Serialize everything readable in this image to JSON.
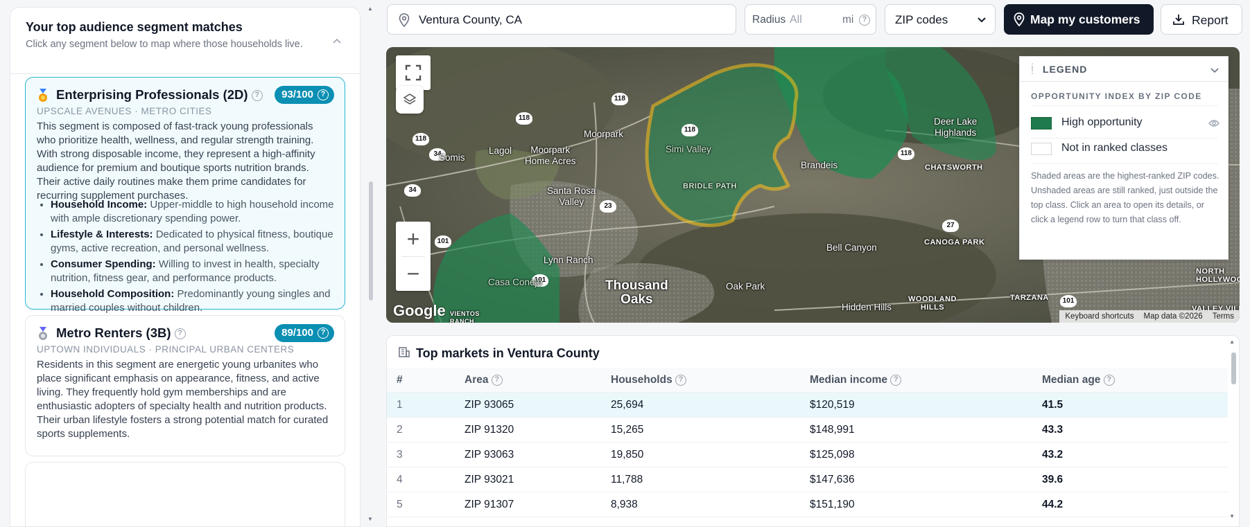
{
  "left_panel": {
    "title": "Your top audience segment matches",
    "subtitle": "Click any segment below to map where those households live.",
    "segments": [
      {
        "medal": "gold-medal-icon",
        "title": "Enterprising Professionals (2D)",
        "score": "93/100",
        "meta": "UPSCALE AVENUES · METRO CITIES",
        "description": "This segment is composed of fast-track young professionals who prioritize health, wellness, and regular strength training. With strong disposable income, they represent a high-affinity audience for premium and boutique sports nutrition brands. Their active daily routines make them prime candidates for recurring supplement purchases.",
        "bullets": [
          {
            "label": "Household Income:",
            "text": "Upper-middle to high household income with ample discretionary spending power."
          },
          {
            "label": "Lifestyle & Interests:",
            "text": "Dedicated to physical fitness, boutique gyms, active recreation, and personal wellness."
          },
          {
            "label": "Consumer Spending:",
            "text": "Willing to invest in health, specialty nutrition, fitness gear, and performance products."
          },
          {
            "label": "Household Composition:",
            "text": "Predominantly young singles and married couples without children."
          }
        ]
      },
      {
        "medal": "silver-medal-icon",
        "title": "Metro Renters (3B)",
        "score": "89/100",
        "meta": "UPTOWN INDIVIDUALS · PRINCIPAL URBAN CENTERS",
        "description": "Residents in this segment are energetic young urbanites who place significant emphasis on appearance, fitness, and active living. They frequently hold gym memberships and are enthusiastic adopters of specialty health and nutrition products. Their urban lifestyle fosters a strong potential match for curated sports supplements."
      }
    ]
  },
  "toolbar": {
    "location_value": "Ventura County, CA",
    "radius_label": "Radius",
    "radius_placeholder": "All",
    "radius_unit": "mi",
    "geo_select_value": "ZIP codes",
    "map_button_label": "Map my customers",
    "report_button_label": "Report"
  },
  "map": {
    "labels": {
      "simi_valley": "Simi Valley",
      "bridle_path": "BRIDLE PATH",
      "moorpark": "Moorpark",
      "moorpark_home_acres": "Moorpark\nHome Acres",
      "lagol": "Lagol",
      "somis": "Somis",
      "santa_rosa_valley": "Santa Rosa\nValley",
      "lynn_ranch": "Lynn Ranch",
      "casa_conejo": "Casa Conejo",
      "thousand_oaks": "Thousand\nOaks",
      "oak_park": "Oak Park",
      "bell_canyon": "Bell Canyon",
      "hidden_hills": "Hidden Hills",
      "brandeis": "Brandeis",
      "deer_lake_highlands": "Deer Lake\nHighlands",
      "chatsworth": "CHATSWORTH",
      "canoga_park": "CANOGA PARK",
      "woodland_hills": "WOODLAND\nHILLS",
      "tarzana": "TARZANA",
      "north_hollywood": "NORTH\nHOLLYWOO",
      "valley_village": "VALLEY VILLAG",
      "vientos_ranch": "VIENTOS\nRANCH"
    },
    "shields": [
      "118",
      "118",
      "118",
      "34",
      "34",
      "23",
      "101",
      "101",
      "27",
      "118",
      "118",
      "101"
    ],
    "google_logo": "Google",
    "attribution": [
      "Keyboard shortcuts",
      "Map data ©2026",
      "Terms"
    ],
    "legend": {
      "title": "LEGEND",
      "subtitle": "OPPORTUNITY INDEX BY ZIP CODE",
      "rows": [
        {
          "label": "High opportunity",
          "color": "#1f7a4d"
        },
        {
          "label": "Not in ranked classes",
          "color": "#ffffff"
        }
      ],
      "note": "Shaded areas are the highest-ranked ZIP codes. Unshaded areas are still ranked, just outside the top class. Click an area to open its details, or click a legend row to turn that class off."
    },
    "colors": {
      "highlight_outline": "#f5c518",
      "opportunity_fill": "#1e8a52"
    }
  },
  "table": {
    "title": "Top markets in Ventura County",
    "columns": [
      "#",
      "Area",
      "Households",
      "Median income",
      "Median age"
    ],
    "rows": [
      {
        "rank": "1",
        "area": "ZIP 93065",
        "households": "25,694",
        "income": "$120,519",
        "age": "41.5"
      },
      {
        "rank": "2",
        "area": "ZIP 91320",
        "households": "15,265",
        "income": "$148,991",
        "age": "43.3"
      },
      {
        "rank": "3",
        "area": "ZIP 93063",
        "households": "19,850",
        "income": "$125,098",
        "age": "43.2"
      },
      {
        "rank": "4",
        "area": "ZIP 93021",
        "households": "11,788",
        "income": "$147,636",
        "age": "39.6"
      },
      {
        "rank": "5",
        "area": "ZIP 91307",
        "households": "8,938",
        "income": "$151,190",
        "age": "44.2"
      }
    ]
  }
}
